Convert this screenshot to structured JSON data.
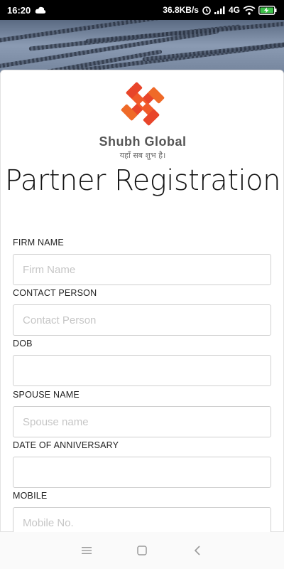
{
  "status_bar": {
    "time": "16:20",
    "speed": "36.8KB/s",
    "network": "4G"
  },
  "brand": {
    "name": "Shubh Global",
    "tagline": "यहाँ सब शुभ है।",
    "logo_colors": [
      "#e8452a",
      "#f08a2a"
    ]
  },
  "page": {
    "title": "Partner Registration"
  },
  "form": {
    "fields": [
      {
        "label": "FIRM NAME",
        "placeholder": "Firm Name",
        "value": ""
      },
      {
        "label": "CONTACT PERSON",
        "placeholder": "Contact Person",
        "value": ""
      },
      {
        "label": "DOB",
        "placeholder": "",
        "value": ""
      },
      {
        "label": "SPOUSE NAME",
        "placeholder": "Spouse name",
        "value": ""
      },
      {
        "label": "DATE OF ANNIVERSARY",
        "placeholder": "",
        "value": ""
      },
      {
        "label": "MOBILE",
        "placeholder": "Mobile No.",
        "value": ""
      }
    ]
  },
  "nav": {
    "icons": [
      "menu-icon",
      "home-square-icon",
      "back-icon"
    ]
  }
}
